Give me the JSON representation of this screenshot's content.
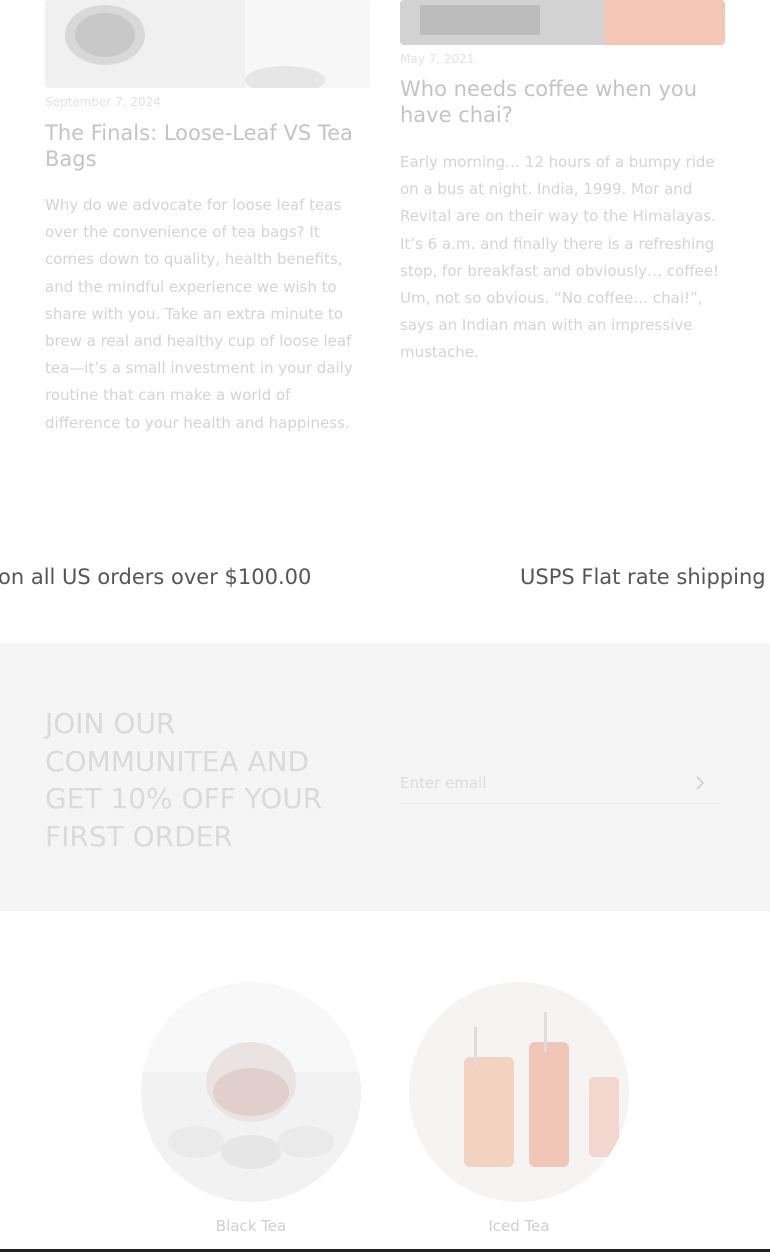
{
  "posts": [
    {
      "date": "September 7, 2024",
      "title": "The Finals: Loose-Leaf VS Tea Bags",
      "excerpt": "Why do we advocate for loose leaf teas over the convenience of tea bags? It comes down to quality, health benefits, and the mindful experience we wish to share with you. Take an extra minute to brew a real and healthy cup of loose leaf tea—it’s a small investment in your daily routine that can make a world of difference to your health and happiness."
    },
    {
      "date": "May 7, 2021",
      "title": "Who needs coffee when you have chai?",
      "excerpt": "Early morning… 12 hours of a bumpy ride on a bus at night. India, 1999. Mor and Revital are on their way to the Himalayas. It’s 6 a.m. and finally there is a refreshing stop, for breakfast and obviously… coffee! Um, not so obvious. “No coffee… chai!”, says an Indian man with an impressive mustache."
    }
  ],
  "marquee": {
    "text_left": "on all US orders over $100.00",
    "text_right": "USPS Flat rate shipping"
  },
  "newsletter": {
    "heading": "JOIN OUR COMMUNITEA AND GET 10% OFF YOUR FIRST ORDER",
    "email_placeholder": "Enter email",
    "submit_icon": "chevron-right-icon"
  },
  "collections": [
    {
      "label": "Black Tea"
    },
    {
      "label": "Iced Tea"
    }
  ],
  "colors": {
    "marquee_text": "#555555",
    "newsletter_bg": "#f5f5f5"
  }
}
